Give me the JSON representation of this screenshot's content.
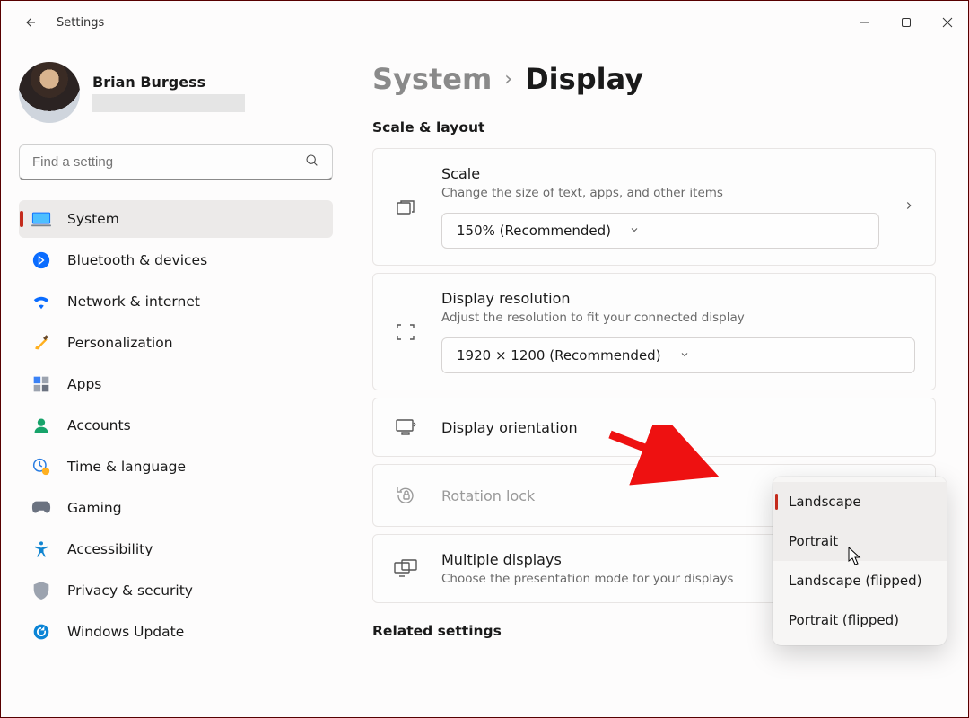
{
  "titlebar": {
    "app_title": "Settings"
  },
  "profile": {
    "name": "Brian Burgess"
  },
  "search": {
    "placeholder": "Find a setting"
  },
  "sidebar": {
    "items": [
      {
        "label": "System"
      },
      {
        "label": "Bluetooth & devices"
      },
      {
        "label": "Network & internet"
      },
      {
        "label": "Personalization"
      },
      {
        "label": "Apps"
      },
      {
        "label": "Accounts"
      },
      {
        "label": "Time & language"
      },
      {
        "label": "Gaming"
      },
      {
        "label": "Accessibility"
      },
      {
        "label": "Privacy & security"
      },
      {
        "label": "Windows Update"
      }
    ]
  },
  "breadcrumb": {
    "parent": "System",
    "sep": "›",
    "current": "Display"
  },
  "section": {
    "scale_layout": "Scale & layout",
    "related": "Related settings"
  },
  "cards": {
    "scale": {
      "title": "Scale",
      "sub": "Change the size of text, apps, and other items",
      "value": "150% (Recommended)"
    },
    "resolution": {
      "title": "Display resolution",
      "sub": "Adjust the resolution to fit your connected display",
      "value": "1920 × 1200 (Recommended)"
    },
    "orientation": {
      "title": "Display orientation"
    },
    "rotation": {
      "title": "Rotation lock"
    },
    "multi": {
      "title": "Multiple displays",
      "sub": "Choose the presentation mode for your displays"
    }
  },
  "popup": {
    "items": [
      {
        "label": "Landscape"
      },
      {
        "label": "Portrait"
      },
      {
        "label": "Landscape (flipped)"
      },
      {
        "label": "Portrait (flipped)"
      }
    ]
  }
}
